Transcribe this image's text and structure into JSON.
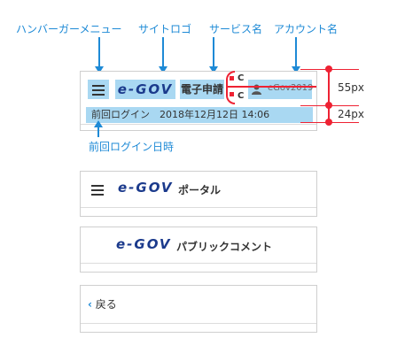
{
  "annotations": {
    "hamburger": "ハンバーガーメニュー",
    "site_logo": "サイトロゴ",
    "service_name": "サービス名",
    "account_name": "アカウント名",
    "last_login": "前回ログイン日時",
    "dim_55": "55px",
    "dim_24": "24px",
    "c_top": "C",
    "c_bottom": "C"
  },
  "header1": {
    "logo": "e-GOV",
    "service": "電子申請",
    "account": "eGov2019",
    "last_login": "前回ログイン　2018年12月12日 14:06"
  },
  "header2": {
    "logo": "e-GOV",
    "title": "ポータル"
  },
  "header3": {
    "logo": "e-GOV",
    "title": "パブリックコメント"
  },
  "header4": {
    "back_label": "戻る"
  },
  "colors": {
    "accent": "#1e8ad6",
    "highlight": "#a9d8f2",
    "marker": "#ee2233",
    "logo": "#1b3a8c"
  }
}
